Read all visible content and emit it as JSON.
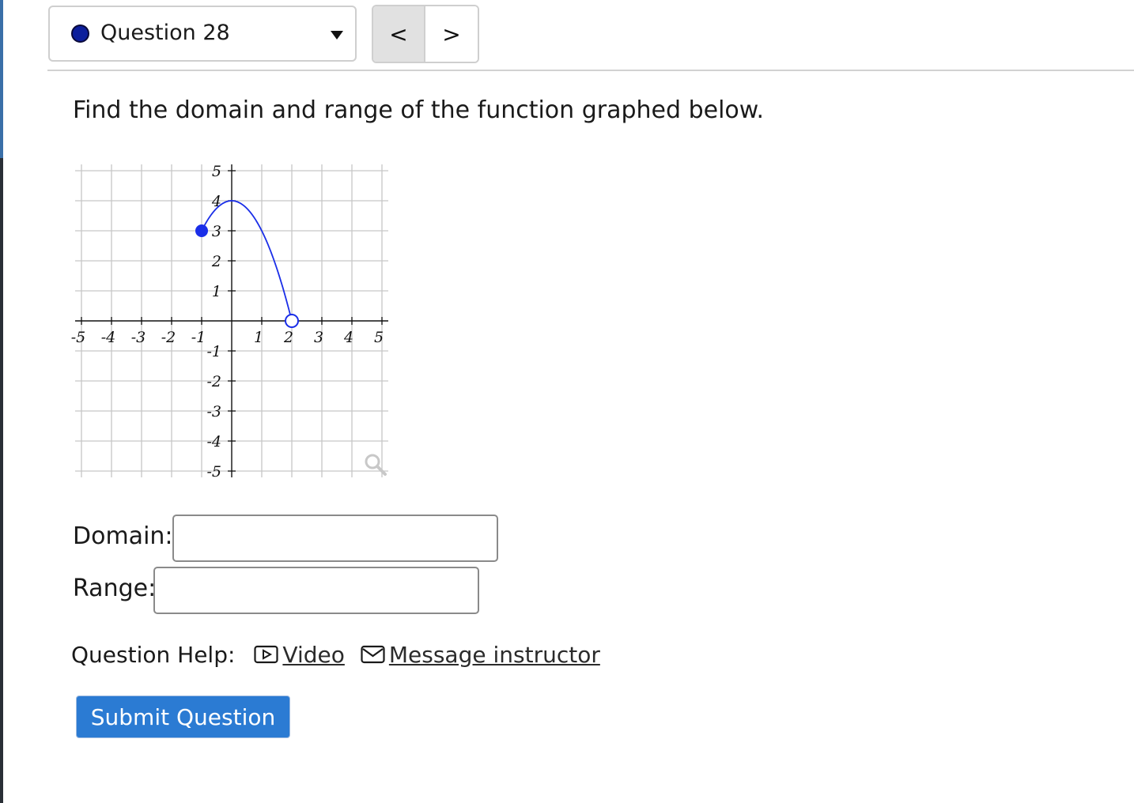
{
  "question_selector": {
    "label": "Question 28",
    "status_icon": "filled-circle-icon",
    "dropdown_icon": "caret-down-icon"
  },
  "navigation": {
    "prev_label": "<",
    "next_label": ">"
  },
  "prompt": "Find the domain and range of the function graphed below.",
  "graph": {
    "x_tick_labels": [
      "-5",
      "-4",
      "-3",
      "-2",
      "-1",
      "1",
      "2",
      "3",
      "4",
      "5"
    ],
    "y_tick_labels": [
      "5",
      "4",
      "3",
      "2",
      "1",
      "-1",
      "-2",
      "-3",
      "-4",
      "-5"
    ],
    "curve_color": "#1a2ee8",
    "closed_endpoint": {
      "x": -1,
      "y": 3
    },
    "open_endpoint": {
      "x": 2,
      "y": 0
    },
    "vertex": {
      "x": 0,
      "y": 4
    },
    "zoom_icon": "magnifier-icon"
  },
  "chart_data": {
    "type": "line",
    "x": [
      -1,
      -0.5,
      0,
      0.5,
      1,
      1.5,
      2
    ],
    "y": [
      3,
      3.75,
      4,
      3.75,
      3,
      1.75,
      0
    ],
    "xlim": [
      -5,
      5
    ],
    "ylim": [
      -5,
      5
    ],
    "grid": true,
    "series": [
      {
        "x": [
          -1,
          -0.5,
          0,
          0.5,
          1,
          1.5,
          2
        ],
        "y": [
          3,
          3.75,
          4,
          3.75,
          3,
          1.75,
          0
        ]
      }
    ],
    "endpoints": [
      {
        "x": -1,
        "y": 3,
        "style": "closed"
      },
      {
        "x": 2,
        "y": 0,
        "style": "open"
      }
    ]
  },
  "fields": {
    "domain_label": "Domain:",
    "domain_value": "",
    "range_label": "Range:",
    "range_value": ""
  },
  "help": {
    "label": "Question Help:",
    "video_label": "Video",
    "video_icon": "video-play-icon",
    "message_label": "Message instructor",
    "message_icon": "envelope-icon"
  },
  "submit_label": "Submit Question",
  "colors": {
    "accent": "#2b7bd3",
    "status_dot": "#0d1f9c"
  }
}
